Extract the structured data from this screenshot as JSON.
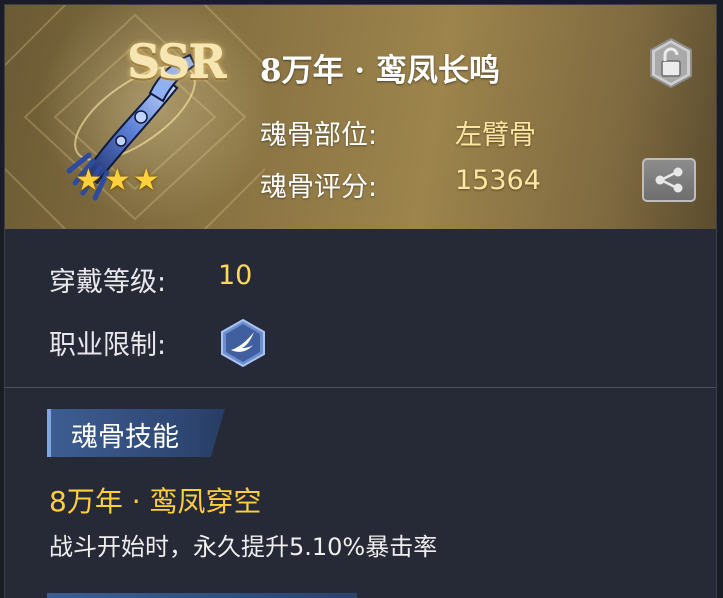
{
  "item": {
    "rarity": "SSR",
    "stars": "★★★",
    "star_count": 3,
    "name": "8万年 · 鸾凤长鸣",
    "part_label": "魂骨部位:",
    "part_value": "左臂骨",
    "score_label": "魂骨评分:",
    "score_value": "15364"
  },
  "requirements": {
    "level_label": "穿戴等级:",
    "level_value": "10",
    "class_label": "职业限制:",
    "class_icon": "wing-icon"
  },
  "skill": {
    "section_title": "魂骨技能",
    "name": "8万年 · 鸾凤穿空",
    "description": "战斗开始时，永久提升5.10%暴击率"
  },
  "icons": {
    "lock": "lock-icon",
    "share": "share-icon"
  },
  "colors": {
    "header_gold": "#8a7443",
    "value_gold": "#ffd85a",
    "skill_name": "#ffcf3e",
    "star": "#ffd23d",
    "panel_bg": "#262a36",
    "tag_blue": "#3d5d91"
  }
}
